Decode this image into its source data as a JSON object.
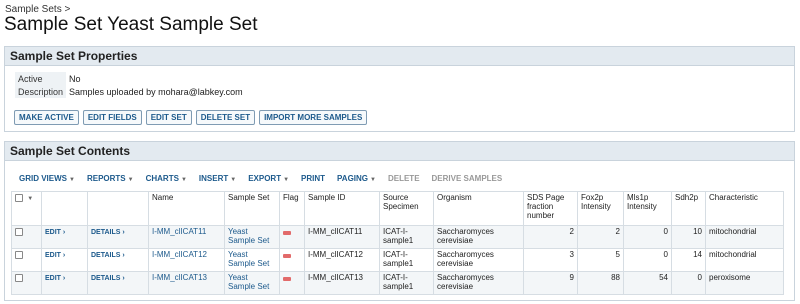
{
  "breadcrumb": "Sample Sets >",
  "page_title": "Sample Set Yeast Sample Set",
  "properties": {
    "heading": "Sample Set Properties",
    "rows": [
      {
        "label": "Active",
        "value": "No"
      },
      {
        "label": "Description",
        "value": "Samples uploaded by mohara@labkey.com"
      }
    ],
    "buttons": [
      "MAKE ACTIVE",
      "EDIT FIELDS",
      "EDIT SET",
      "DELETE SET",
      "IMPORT MORE SAMPLES"
    ]
  },
  "contents": {
    "heading": "Sample Set Contents",
    "toolbar": {
      "grid_views": "GRID VIEWS",
      "reports": "REPORTS",
      "charts": "CHARTS",
      "insert": "INSERT",
      "export": "EXPORT",
      "print": "PRINT",
      "paging": "PAGING",
      "delete": "DELETE",
      "derive": "DERIVE SAMPLES"
    },
    "columns": [
      "Name",
      "Sample Set",
      "Flag",
      "Sample ID",
      "Source Specimen",
      "Organism",
      "SDS Page fraction number",
      "Fox2p Intensity",
      "Mls1p Intensity",
      "Sdh2p",
      "Characteristic"
    ],
    "edit_label": "EDIT",
    "details_label": "DETAILS",
    "rows": [
      {
        "name": "I-MM_clICAT11",
        "sample_set": "Yeast Sample Set",
        "sample_id": "I-MM_clICAT11",
        "source": "ICAT-I-sample1",
        "organism": "Saccharomyces cerevisiae",
        "sds": "2",
        "fox2p": "2",
        "mls1p": "0",
        "sdh2p": "10",
        "characteristic": "mitochondrial"
      },
      {
        "name": "I-MM_clICAT12",
        "sample_set": "Yeast Sample Set",
        "sample_id": "I-MM_clICAT12",
        "source": "ICAT-I-sample1",
        "organism": "Saccharomyces cerevisiae",
        "sds": "3",
        "fox2p": "5",
        "mls1p": "0",
        "sdh2p": "14",
        "characteristic": "mitochondrial"
      },
      {
        "name": "I-MM_clICAT13",
        "sample_set": "Yeast Sample Set",
        "sample_id": "I-MM_clICAT13",
        "source": "ICAT-I-sample1",
        "organism": "Saccharomyces cerevisiae",
        "sds": "9",
        "fox2p": "88",
        "mls1p": "54",
        "sdh2p": "0",
        "characteristic": "peroxisome"
      }
    ]
  }
}
